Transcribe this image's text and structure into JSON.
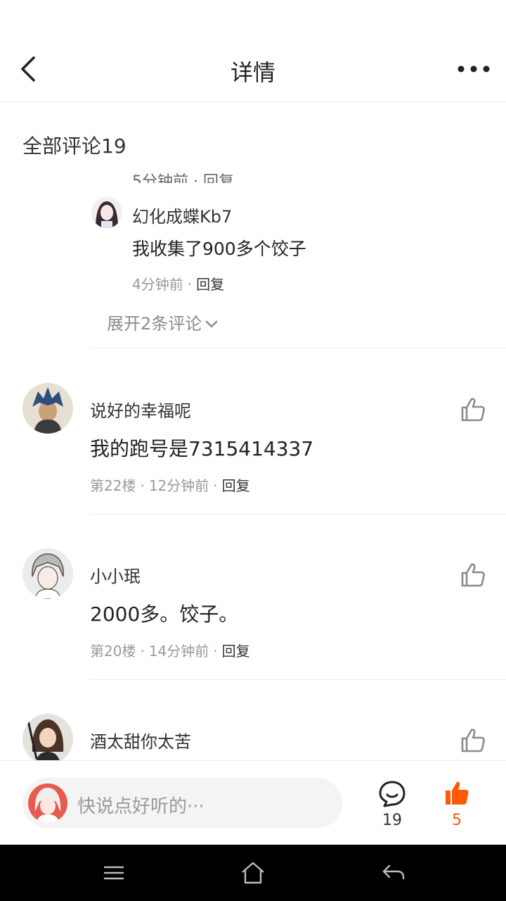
{
  "header": {
    "title": "详情"
  },
  "section": {
    "title": "全部评论19",
    "cut_text": "5分钟前 · 回复"
  },
  "reply": {
    "name": "幻化成蝶Kb7",
    "text": "我收集了900多个饺子",
    "time": "4分钟前",
    "reply_label": "回复"
  },
  "expand": {
    "label": "展开2条评论"
  },
  "comments": [
    {
      "name": "说好的幸福呢",
      "text": "我的跑号是7315414337",
      "floor": "第22楼",
      "time": "12分钟前",
      "reply_label": "回复"
    },
    {
      "name": "小小珉",
      "text": "2000多。饺子。",
      "floor": "第20楼",
      "time": "14分钟前",
      "reply_label": "回复"
    },
    {
      "name": "酒太甜你太苦"
    }
  ],
  "bottom_bar": {
    "placeholder": "快说点好听的···",
    "comment_count": "19",
    "like_count": "5"
  },
  "colors": {
    "accent": "#ff5a0a",
    "divider": "#ececec",
    "meta": "#999999"
  },
  "icons": [
    "back-icon",
    "more-icon",
    "chevron-down-icon",
    "thumbs-up-icon",
    "comment-bubble-icon",
    "menu-icon",
    "home-icon",
    "return-icon"
  ]
}
